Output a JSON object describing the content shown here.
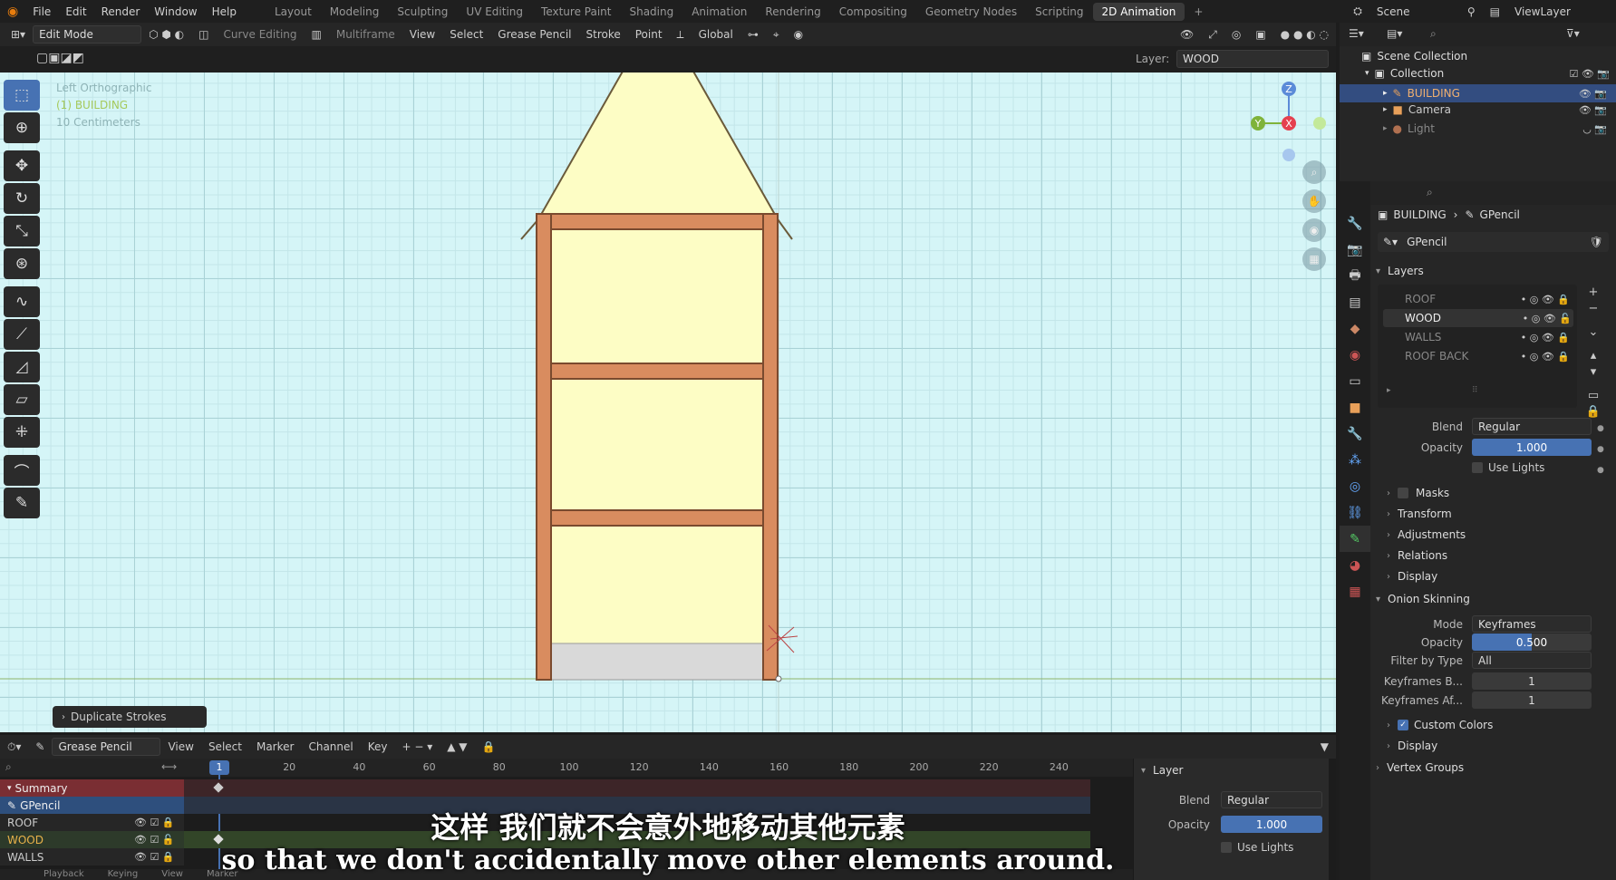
{
  "menu": {
    "items": [
      "File",
      "Edit",
      "Render",
      "Window",
      "Help"
    ],
    "workspaces": [
      "Layout",
      "Modeling",
      "Sculpting",
      "UV Editing",
      "Texture Paint",
      "Shading",
      "Animation",
      "Rendering",
      "Compositing",
      "Geometry Nodes",
      "Scripting",
      "2D Animation"
    ],
    "active_workspace": "2D Animation",
    "scene": "Scene",
    "view_layer": "ViewLayer"
  },
  "viewport_header": {
    "mode": "Edit Mode",
    "curve_editing": "Curve Editing",
    "multiframe": "Multiframe",
    "menus": [
      "View",
      "Select",
      "Grease Pencil",
      "Stroke",
      "Point"
    ],
    "orientation": "Global",
    "layer_label": "Layer:",
    "layer_value": "WOOD"
  },
  "viewport": {
    "view_name": "Left Orthographic",
    "object_name": "(1) BUILDING",
    "scale": "10 Centimeters",
    "gizmo": {
      "z": "Z",
      "y": "Y",
      "x": "X"
    },
    "operator_panel": "Duplicate Strokes"
  },
  "timeline": {
    "editor": "Grease Pencil",
    "menus": [
      "View",
      "Select",
      "Marker",
      "Channel",
      "Key"
    ],
    "current_frame": "1",
    "frame_ticks": [
      "20",
      "40",
      "60",
      "80",
      "100",
      "120",
      "140",
      "160",
      "180",
      "200",
      "220",
      "240"
    ],
    "channels": {
      "summary": "Summary",
      "object": "GPencil",
      "layers": [
        "ROOF",
        "WOOD",
        "WALLS"
      ]
    },
    "side_panel": {
      "title": "Layer",
      "blend_label": "Blend",
      "blend_value": "Regular",
      "opacity_label": "Opacity",
      "opacity_value": "1.000",
      "use_lights": "Use Lights"
    },
    "footer": [
      "Playback",
      "Keying",
      "View",
      "Marker"
    ]
  },
  "outliner": {
    "root": "Scene Collection",
    "collection": "Collection",
    "items": [
      "BUILDING",
      "Camera",
      "Light"
    ]
  },
  "properties": {
    "breadcrumb_object": "BUILDING",
    "breadcrumb_data": "GPencil",
    "datablock": "GPencil",
    "layers_title": "Layers",
    "layers": [
      "ROOF",
      "WOOD",
      "WALLS",
      "ROOF BACK"
    ],
    "active_layer": "WOOD",
    "blend_label": "Blend",
    "blend_value": "Regular",
    "opacity_label": "Opacity",
    "opacity_value": "1.000",
    "use_lights": "Use Lights",
    "collapsed_panels": [
      "Masks",
      "Transform",
      "Adjustments",
      "Relations",
      "Display"
    ],
    "onion": {
      "title": "Onion Skinning",
      "mode_label": "Mode",
      "mode_value": "Keyframes",
      "opacity_label": "Opacity",
      "opacity_value": "0.500",
      "filter_label": "Filter by Type",
      "filter_value": "All",
      "before_label": "Keyframes B...",
      "before_value": "1",
      "after_label": "Keyframes Af...",
      "after_value": "1",
      "custom_colors": "Custom Colors",
      "display": "Display"
    },
    "vertex_groups": "Vertex Groups"
  },
  "subtitles": {
    "zh": "这样 我们就不会意外地移动其他元素",
    "en": "so that we don't accidentally move other elements around."
  },
  "colors": {
    "accent": "#4772b3",
    "wall_fill": "#fdfdc5",
    "wood": "#d98c5f",
    "viewport_bg": "#d5f5f7"
  }
}
